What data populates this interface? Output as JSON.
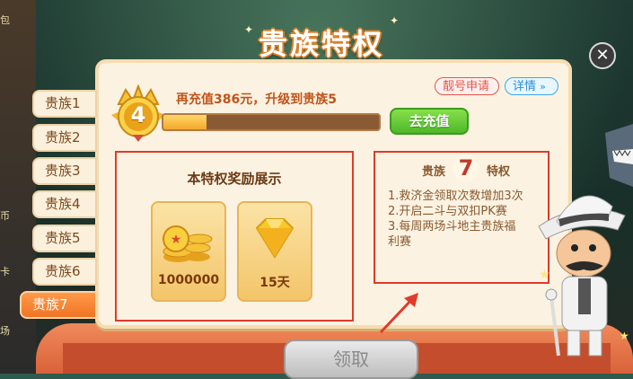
{
  "title": "贵族特权",
  "sidebar": {
    "left_edge_labels": [
      "包",
      "币",
      "卡",
      "场"
    ],
    "tabs": [
      {
        "label": "贵族1"
      },
      {
        "label": "贵族2"
      },
      {
        "label": "贵族3"
      },
      {
        "label": "贵族4"
      },
      {
        "label": "贵族5"
      },
      {
        "label": "贵族6"
      },
      {
        "label": "贵族7",
        "active": true
      }
    ]
  },
  "header": {
    "level_badge": "4",
    "upgrade_text": "再充值386元，升级到贵族5",
    "progress_fraction": 0.2,
    "pretty_id_button": "靓号申请",
    "details_button": "详情",
    "recharge_button": "去充值"
  },
  "rewards": {
    "title": "本特权奖励展示",
    "items": [
      {
        "label": "1000000",
        "icon": "gold-coins-icon"
      },
      {
        "label": "15天",
        "icon": "gem-icon"
      }
    ]
  },
  "privilege": {
    "prefix": "贵族",
    "number": "7",
    "suffix": "特权",
    "items": [
      "1.救济金领取次数增加3次",
      "2.开启二斗与双扣PK赛",
      "3.每周两场斗地主贵族福",
      "利赛"
    ]
  },
  "claim_button": "领取",
  "colors": {
    "accent": "#f07424",
    "highlight_border": "#e23a2a",
    "recharge": "#4fb82a"
  }
}
